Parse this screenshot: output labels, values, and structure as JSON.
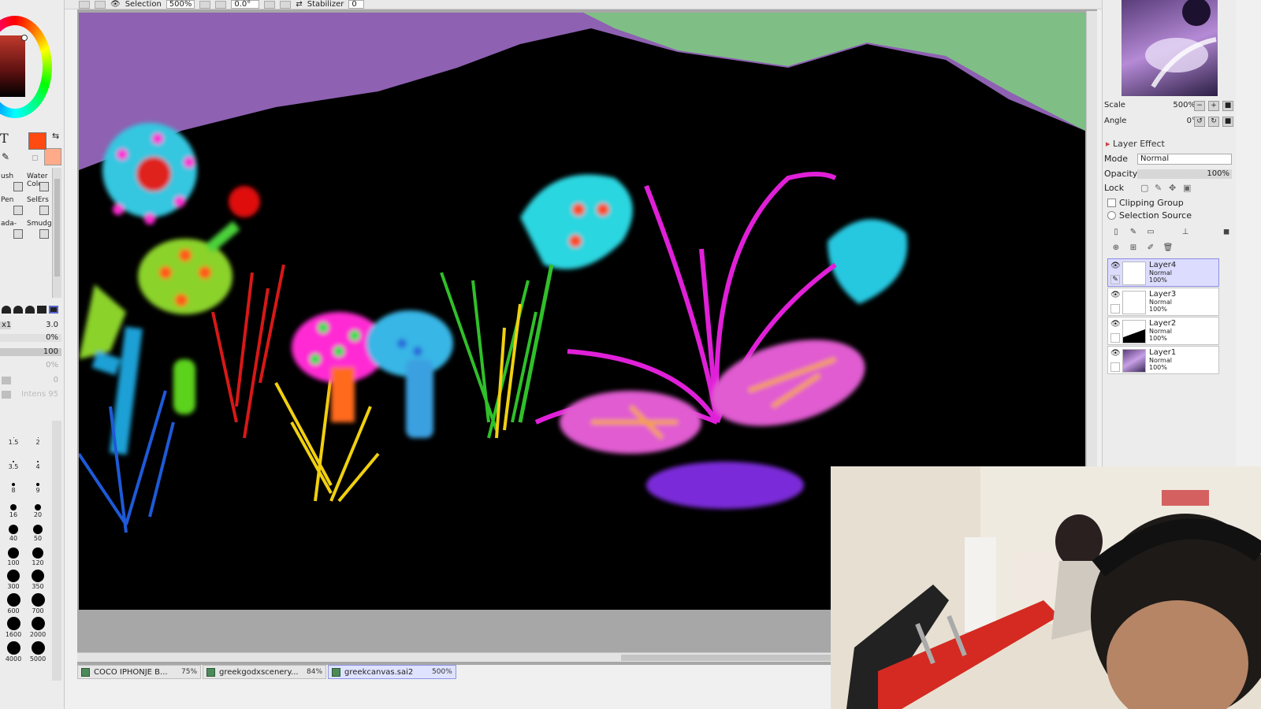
{
  "toolbar": {
    "selection_label": "Selection",
    "zoom_value": "500%",
    "rotation_value": "0.0°",
    "stabilizer_label": "Stabilizer",
    "stabilizer_value": "0"
  },
  "colors": {
    "foreground": "#ff4a12",
    "background": "#ffab8a"
  },
  "tools": {
    "text_glyph": "T",
    "items": [
      {
        "label": "ush",
        "icon": "brush-icon"
      },
      {
        "label": "Water Color",
        "icon": "watercolor-icon"
      },
      {
        "label": "Pen",
        "icon": "pen-icon"
      },
      {
        "label": "SelErs",
        "icon": "selection-eraser-icon"
      },
      {
        "label": "ada-",
        "icon": "gradient-icon"
      },
      {
        "label": "Smudge",
        "icon": "smudge-icon"
      }
    ]
  },
  "brush_params": {
    "size_prefix": "x1",
    "size_value": "3.0",
    "min_size": "0%",
    "density": "100",
    "blending": "0%",
    "persistence": "0",
    "intensity_label": "Intens",
    "intensity_value": "95"
  },
  "brush_sizes": [
    "1.5",
    "2",
    "3.5",
    "4",
    "8",
    "9",
    "16",
    "20",
    "40",
    "50",
    "100",
    "120",
    "300",
    "350",
    "600",
    "700",
    "1600",
    "2000",
    "4000",
    "5000"
  ],
  "tabs": [
    {
      "name": "COCO IPHONJE B...",
      "zoom": "75%",
      "active": false
    },
    {
      "name": "greekgodxscenery...",
      "zoom": "84%",
      "active": false
    },
    {
      "name": "greekcanvas.sai2",
      "zoom": "500%",
      "active": true
    }
  ],
  "navigator": {
    "scale_label": "Scale",
    "scale_value": "500%",
    "angle_label": "Angle",
    "angle_value": "0°"
  },
  "layer_effect": {
    "title": "Layer Effect",
    "mode_label": "Mode",
    "mode_value": "Normal",
    "opacity_label": "Opacity",
    "opacity_value": "100%",
    "lock_label": "Lock",
    "clipping_group_label": "Clipping Group",
    "selection_source_label": "Selection Source"
  },
  "layers": [
    {
      "name": "Layer4",
      "mode": "Normal",
      "opacity": "100%",
      "selected": true
    },
    {
      "name": "Layer3",
      "mode": "Normal",
      "opacity": "100%",
      "selected": false
    },
    {
      "name": "Layer2",
      "mode": "Normal",
      "opacity": "100%",
      "selected": false
    },
    {
      "name": "Layer1",
      "mode": "Normal",
      "opacity": "100%",
      "selected": false
    }
  ]
}
